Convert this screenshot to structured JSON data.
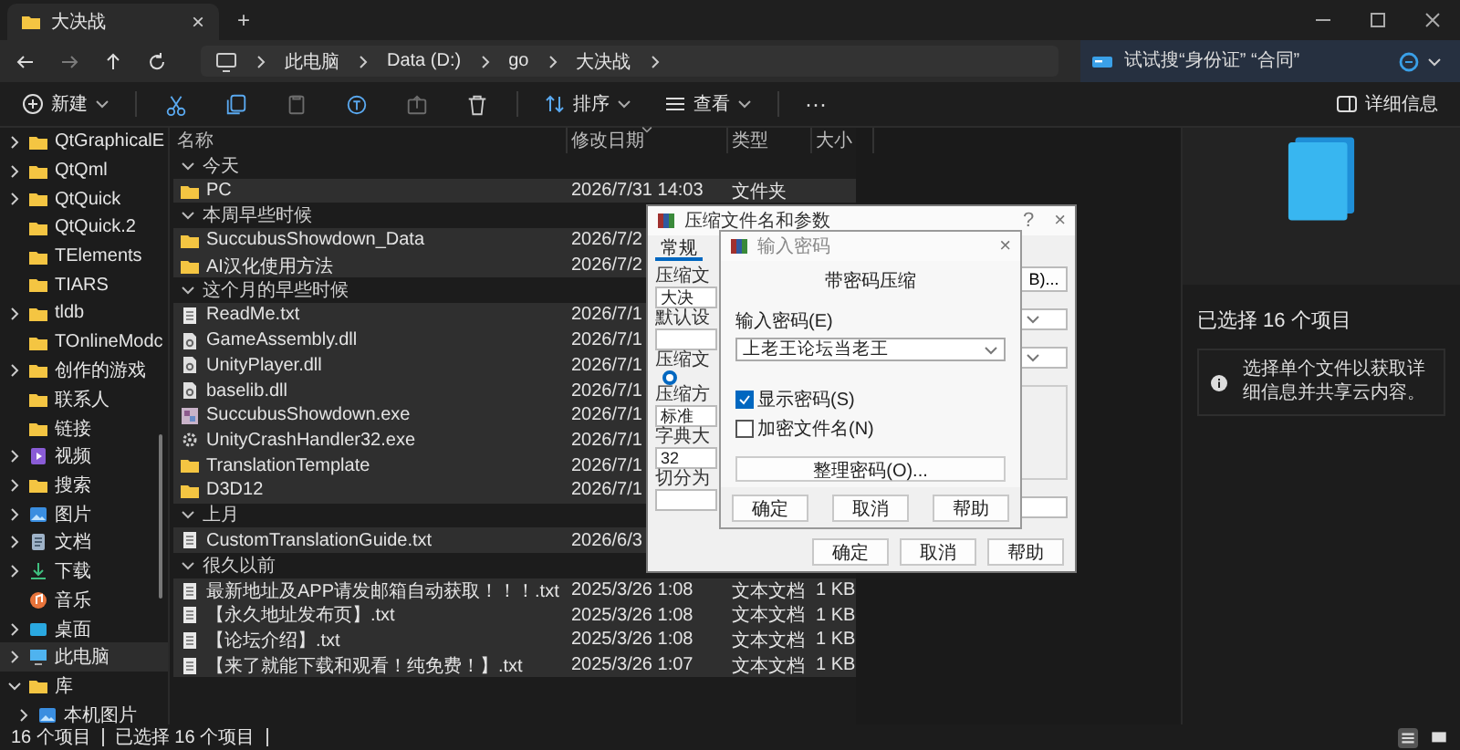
{
  "window": {
    "tab_title": "大决战",
    "tab_close": "×",
    "new_tab": "+"
  },
  "nav": [
    {
      "kind": "back",
      "disabled": false
    },
    {
      "kind": "forward",
      "disabled": true
    },
    {
      "kind": "up",
      "disabled": false
    },
    {
      "kind": "refresh",
      "disabled": false
    }
  ],
  "address": {
    "crumbs": [
      "此电脑",
      "Data (D:)",
      "go",
      "大决战"
    ]
  },
  "search": {
    "placeholder": "试试搜“身份证” “合同”"
  },
  "toolbar": {
    "new": "新建",
    "actions": [
      {
        "kind": "cut",
        "disabled": false
      },
      {
        "kind": "copy",
        "disabled": false
      },
      {
        "kind": "paste",
        "disabled": true
      },
      {
        "kind": "rename",
        "disabled": false
      },
      {
        "kind": "share",
        "disabled": true
      },
      {
        "kind": "delete",
        "disabled": false
      }
    ],
    "sort": "排序",
    "view": "查看",
    "more": "···",
    "details": "详细信息"
  },
  "sidebar": {
    "items": [
      {
        "label": "QtGraphicalE",
        "kind": "folder",
        "expandable": true,
        "expanded": false,
        "selected": false
      },
      {
        "label": "QtQml",
        "kind": "folder",
        "expandable": true,
        "expanded": false,
        "selected": false
      },
      {
        "label": "QtQuick",
        "kind": "folder",
        "expandable": true,
        "expanded": false,
        "selected": false
      },
      {
        "label": "QtQuick.2",
        "kind": "folder",
        "expandable": false,
        "selected": false
      },
      {
        "label": "TElements",
        "kind": "folder",
        "expandable": false,
        "selected": false
      },
      {
        "label": "TIARS",
        "kind": "folder",
        "expandable": false,
        "selected": false
      },
      {
        "label": "tldb",
        "kind": "folder",
        "expandable": true,
        "expanded": false,
        "selected": false
      },
      {
        "label": "TOnlineModc",
        "kind": "folder",
        "expandable": false,
        "selected": false
      },
      {
        "label": "创作的游戏",
        "kind": "folder",
        "expandable": true,
        "expanded": false,
        "selected": false
      },
      {
        "label": "联系人",
        "kind": "folder",
        "expandable": false,
        "selected": false
      },
      {
        "label": "链接",
        "kind": "folder",
        "expandable": false,
        "selected": false
      },
      {
        "label": "视频",
        "kind": "video",
        "expandable": true,
        "expanded": false,
        "selected": false
      },
      {
        "label": "搜索",
        "kind": "folder",
        "expandable": true,
        "expanded": false,
        "selected": false
      },
      {
        "label": "图片",
        "kind": "picture",
        "expandable": true,
        "expanded": false,
        "selected": false
      },
      {
        "label": "文档",
        "kind": "document",
        "expandable": true,
        "expanded": false,
        "selected": false
      },
      {
        "label": "下载",
        "kind": "download",
        "expandable": true,
        "expanded": false,
        "selected": false
      },
      {
        "label": "音乐",
        "kind": "music",
        "expandable": false,
        "selected": false
      },
      {
        "label": "桌面",
        "kind": "desktop",
        "expandable": true,
        "expanded": false,
        "selected": false
      },
      {
        "label": "此电脑",
        "kind": "computer",
        "expandable": true,
        "expanded": false,
        "selected": true
      },
      {
        "label": "库",
        "kind": "folder",
        "expandable": true,
        "expanded": true,
        "selected": false,
        "children": [
          {
            "label": "本机图片",
            "kind": "picture",
            "expandable": true,
            "expanded": false,
            "selected": false
          }
        ]
      }
    ]
  },
  "file_list": {
    "columns": [
      "名称",
      "修改日期",
      "类型",
      "大小"
    ],
    "groups": [
      {
        "label": "今天",
        "expanded": true,
        "files": [
          {
            "name": "PC",
            "kind": "folder",
            "date": "2026/7/31 14:03",
            "type": "文件夹",
            "selected": true
          }
        ]
      },
      {
        "label": "本周早些时候",
        "expanded": true,
        "files": [
          {
            "name": "SuccubusShowdown_Data",
            "kind": "folder",
            "date": "2026/7/2",
            "selected": true
          },
          {
            "name": "AI汉化使用方法",
            "kind": "folder",
            "date": "2026/7/2",
            "selected": true
          }
        ]
      },
      {
        "label": "这个月的早些时候",
        "expanded": true,
        "files": [
          {
            "name": "ReadMe.txt",
            "kind": "text",
            "date": "2026/7/1",
            "selected": true
          },
          {
            "name": "GameAssembly.dll",
            "kind": "dll",
            "date": "2026/7/1",
            "selected": true
          },
          {
            "name": "UnityPlayer.dll",
            "kind": "dll",
            "date": "2026/7/1",
            "selected": true
          },
          {
            "name": "baselib.dll",
            "kind": "dll",
            "date": "2026/7/1",
            "selected": true
          },
          {
            "name": "SuccubusShowdown.exe",
            "kind": "exe",
            "date": "2026/7/1",
            "selected": true
          },
          {
            "name": "UnityCrashHandler32.exe",
            "kind": "gear",
            "date": "2026/7/1",
            "selected": true
          },
          {
            "name": "TranslationTemplate",
            "kind": "folder",
            "date": "2026/7/1",
            "selected": true
          },
          {
            "name": "D3D12",
            "kind": "folder",
            "date": "2026/7/1",
            "selected": true
          }
        ]
      },
      {
        "label": "上月",
        "expanded": true,
        "files": [
          {
            "name": "CustomTranslationGuide.txt",
            "kind": "text",
            "date": "2026/6/3",
            "selected": true
          }
        ]
      },
      {
        "label": "很久以前",
        "expanded": true,
        "files": [
          {
            "name": "最新地址及APP请发邮箱自动获取！！！.txt",
            "kind": "text",
            "date": "2025/3/26 1:08",
            "type": "文本文档",
            "size": "1 KB",
            "selected": true
          },
          {
            "name": "【永久地址发布页】.txt",
            "kind": "text",
            "date": "2025/3/26 1:08",
            "type": "文本文档",
            "size": "1 KB",
            "selected": true
          },
          {
            "name": "【论坛介绍】.txt",
            "kind": "text",
            "date": "2025/3/26 1:08",
            "type": "文本文档",
            "size": "1 KB",
            "selected": true
          },
          {
            "name": "【来了就能下载和观看！纯免费！】.txt",
            "kind": "text",
            "date": "2025/3/26 1:07",
            "type": "文本文档",
            "size": "1 KB",
            "selected": true
          }
        ]
      }
    ]
  },
  "details_pane": {
    "title": "已选择 16 个项目",
    "info": "选择单个文件以获取详细信息并共享云内容。"
  },
  "status_bar": {
    "count": "16 个项目",
    "selection": "已选择 16 个项目",
    "views": [
      {
        "kind": "details",
        "selected": true
      },
      {
        "kind": "tiles",
        "selected": false
      }
    ]
  },
  "archive_dialog": {
    "title": "压缩文件名和参数",
    "help": "?",
    "close": "×",
    "tabs": [
      {
        "label": "常规",
        "selected": true
      }
    ],
    "left_controls": [
      {
        "kind": "label",
        "text": "压缩文"
      },
      {
        "kind": "field",
        "value": "大决"
      },
      {
        "kind": "label",
        "text": "默认设"
      },
      {
        "kind": "field"
      },
      {
        "kind": "label",
        "text": "压缩文"
      },
      {
        "kind": "radio",
        "selected": true
      },
      {
        "kind": "label",
        "text": "压缩方"
      },
      {
        "kind": "field",
        "value": "标准"
      },
      {
        "kind": "label",
        "text": "字典大"
      },
      {
        "kind": "field",
        "value": "32"
      },
      {
        "kind": "label",
        "text": "切分为"
      },
      {
        "kind": "field"
      }
    ],
    "right_controls": [
      {
        "kind": "button",
        "text": "B)..."
      },
      {
        "kind": "dropdown"
      },
      {
        "kind": "dropdown"
      },
      {
        "kind": "group"
      },
      {
        "kind": "field"
      }
    ],
    "buttons": [
      "确定",
      "取消",
      "帮助"
    ]
  },
  "password_dialog": {
    "title": "输入密码",
    "close": "×",
    "heading": "带密码压缩",
    "password_label": "输入密码(E)",
    "password": "上老王论坛当老王",
    "options": [
      {
        "label": "显示密码(S)",
        "checked": true
      },
      {
        "label": "加密文件名(N)",
        "checked": false
      }
    ],
    "organize": "整理密码(O)...",
    "buttons": [
      "确定",
      "取消",
      "帮助"
    ]
  }
}
